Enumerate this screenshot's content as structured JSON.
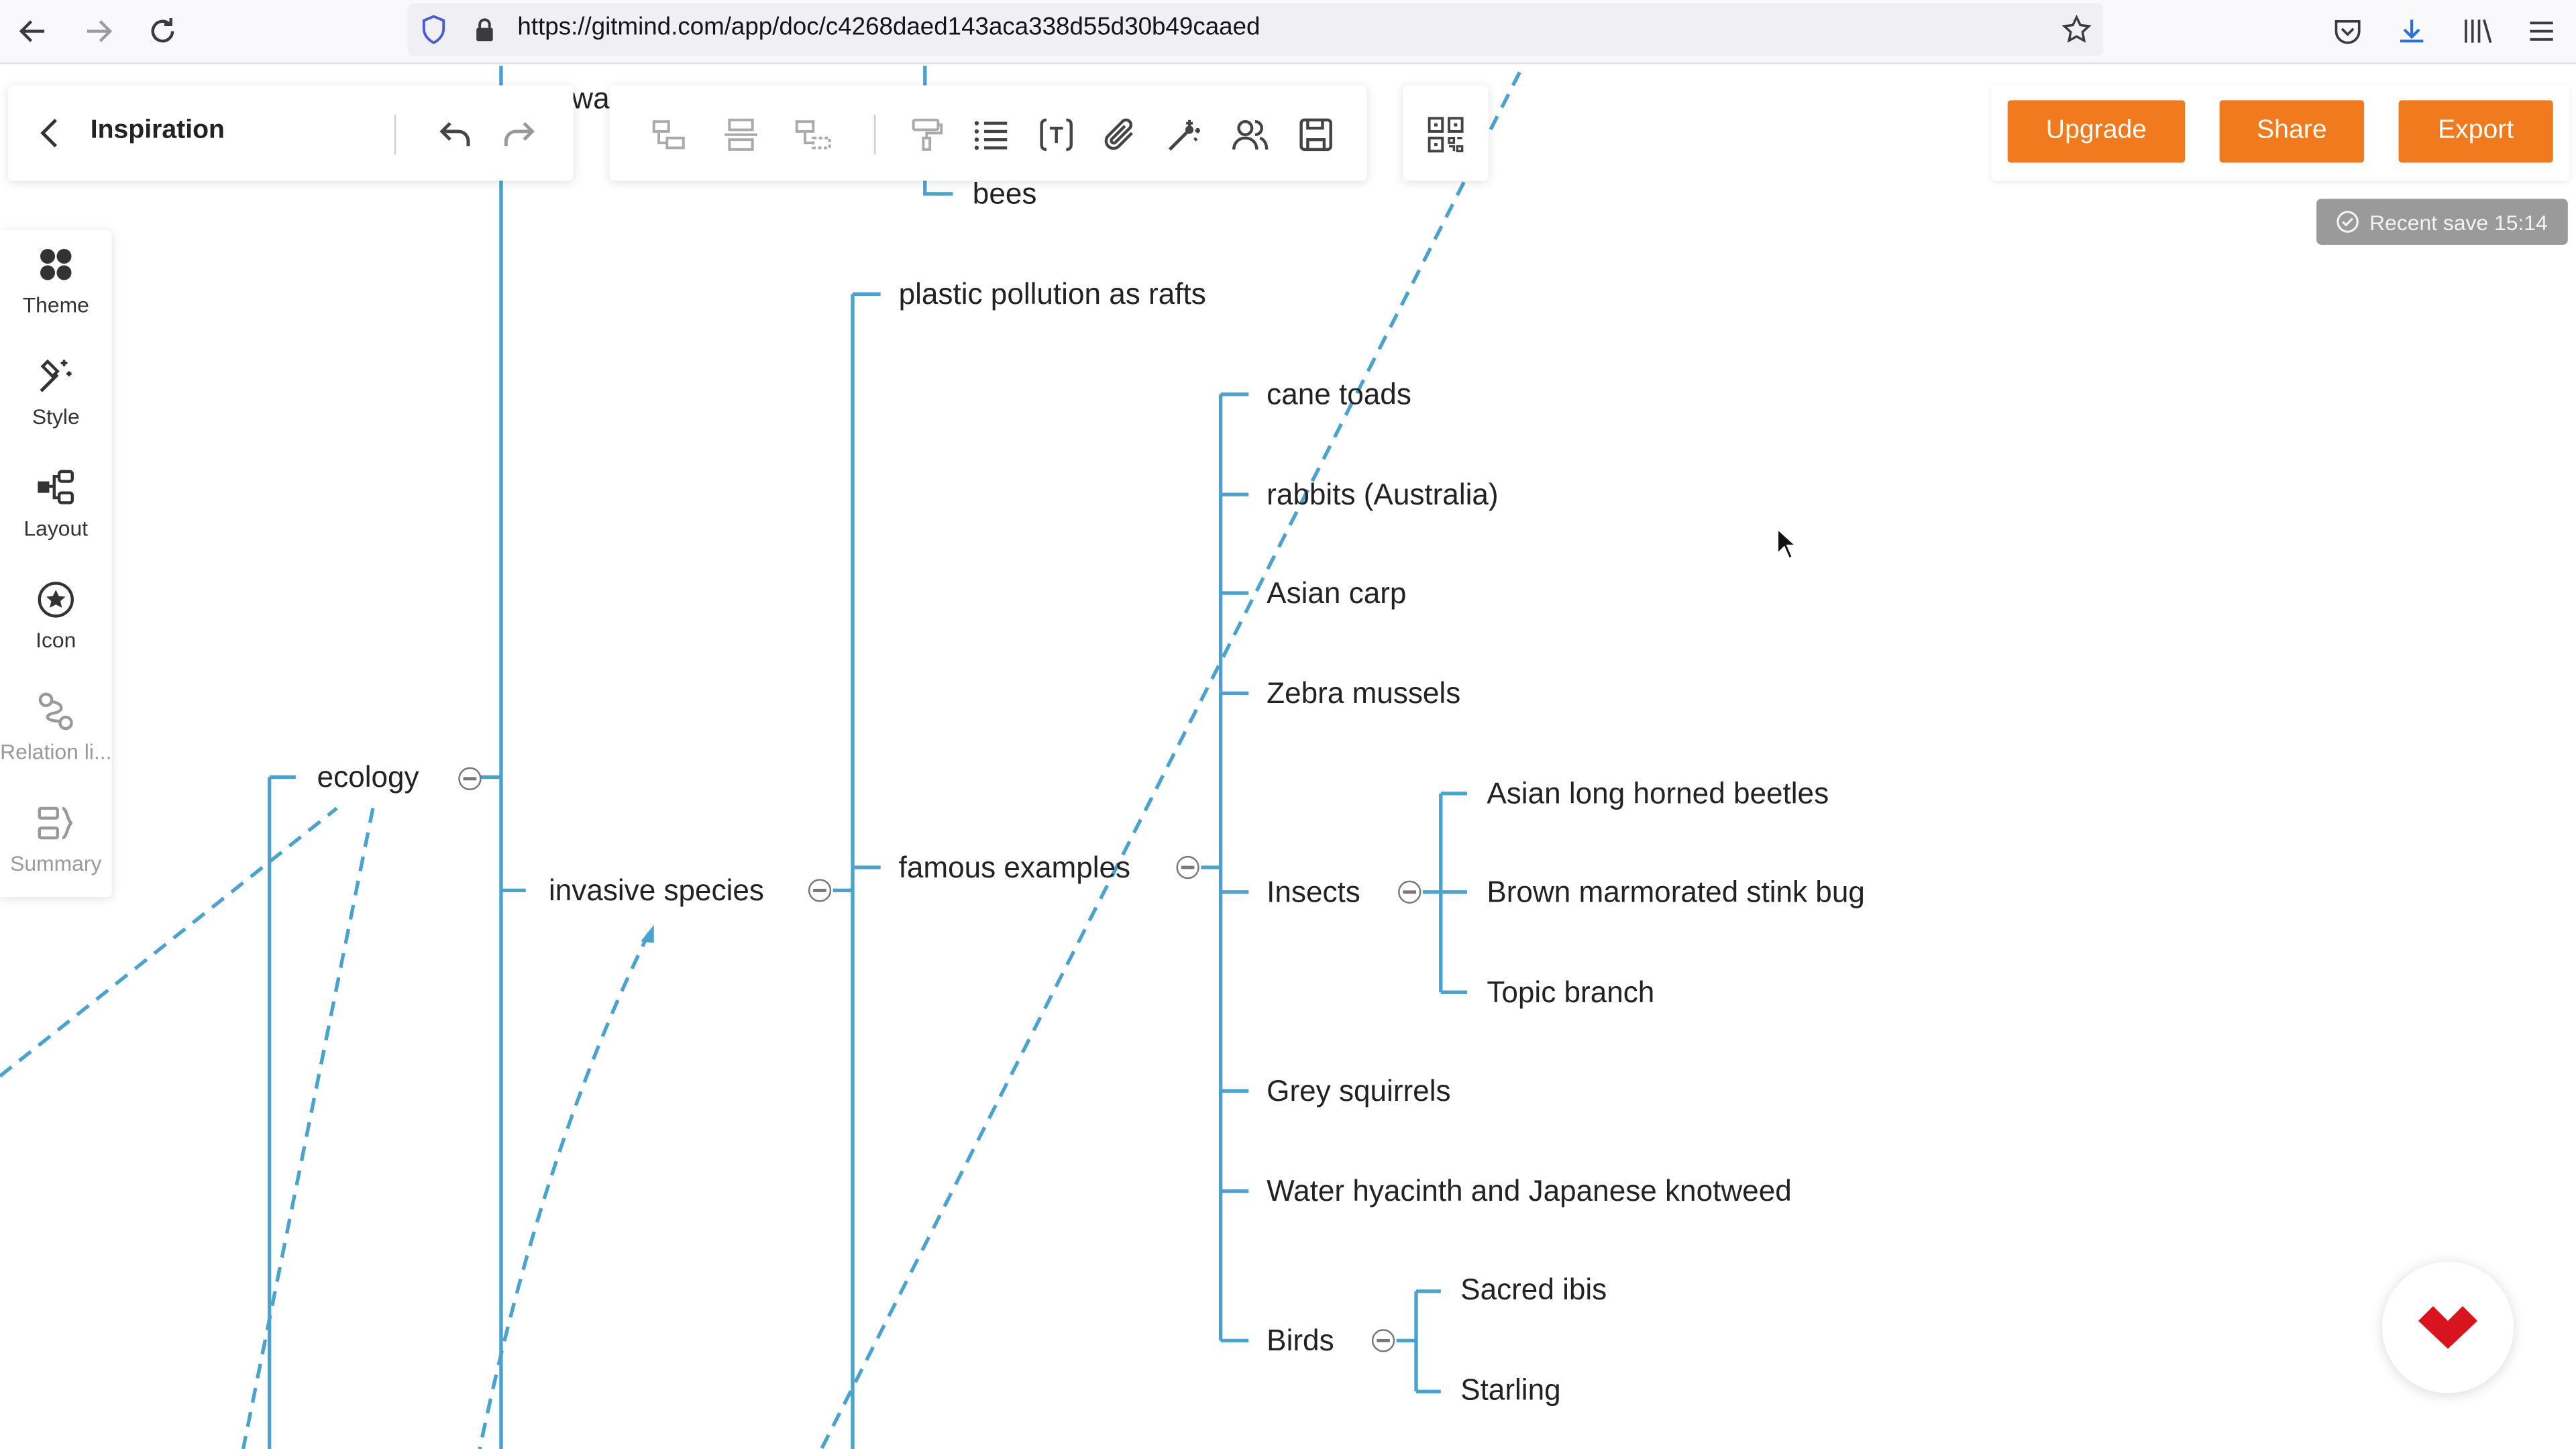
{
  "browser": {
    "url": "https://gitmind.com/app/doc/c4268daed143aca338d55d30b49caaed"
  },
  "header": {
    "doc_title": "Inspiration",
    "upgrade_label": "Upgrade",
    "share_label": "Share",
    "export_label": "Export",
    "save_status": "Recent save 15:14"
  },
  "sidebar": {
    "items": [
      {
        "label": "Theme",
        "icon": "theme-icon"
      },
      {
        "label": "Style",
        "icon": "style-icon"
      },
      {
        "label": "Layout",
        "icon": "layout-icon"
      },
      {
        "label": "Icon",
        "icon": "icon-icon"
      },
      {
        "label": "Relation li...",
        "icon": "relation-line-icon"
      },
      {
        "label": "Summary",
        "icon": "summary-icon"
      }
    ]
  },
  "mindmap": {
    "partial_top": "war",
    "ecology": "ecology",
    "invasive_species": "invasive species",
    "bees": "bees",
    "plastic": "plastic pollution as rafts",
    "famous_examples": "famous examples",
    "examples": [
      "cane toads",
      "rabbits (Australia)",
      "Asian carp",
      "Zebra mussels",
      "Insects",
      "Grey squirrels",
      "Water hyacinth and Japanese knotweed",
      "Birds"
    ],
    "insects": [
      "Asian long horned beetles",
      "Brown marmorated stink bug",
      "Topic branch"
    ],
    "birds": [
      "Sacred ibis",
      "Starling"
    ]
  },
  "colors": {
    "branch": "#4aa3cf",
    "accent": "#f07a1d",
    "save_badge": "#9a9a9a"
  }
}
